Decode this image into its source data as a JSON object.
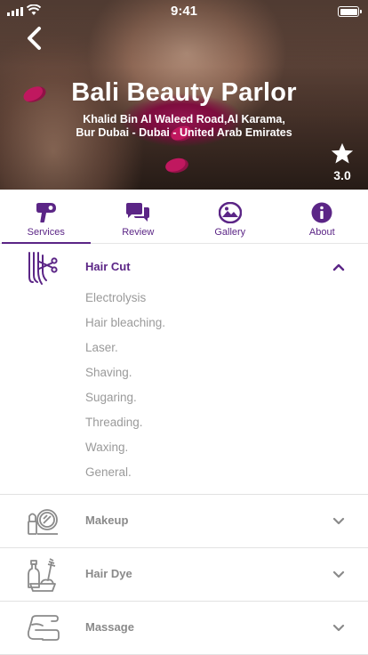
{
  "status_bar": {
    "time": "9:41"
  },
  "salon": {
    "name": "Bali Beauty Parlor",
    "address_line1": "Khalid Bin Al Waleed Road,Al Karama,",
    "address_line2": "Bur Dubai - Dubai - United Arab Emirates",
    "rating": "3.0"
  },
  "tabs": [
    {
      "label": "Services",
      "icon": "hair-dryer-icon",
      "active": true
    },
    {
      "label": "Review",
      "icon": "chat-bubbles-icon",
      "active": false
    },
    {
      "label": "Gallery",
      "icon": "image-icon",
      "active": false
    },
    {
      "label": "About",
      "icon": "info-icon",
      "active": false
    }
  ],
  "services": {
    "expanded": {
      "title": "Hair Cut",
      "icon": "hair-comb-scissors-icon",
      "items": [
        "Electrolysis",
        "Hair bleaching.",
        "Laser.",
        "Shaving.",
        "Sugaring.",
        "Threading.",
        "Waxing.",
        "General."
      ]
    },
    "collapsed": [
      {
        "title": "Makeup",
        "icon": "makeup-mirror-icon"
      },
      {
        "title": "Hair Dye",
        "icon": "hair-dye-icon"
      },
      {
        "title": "Massage",
        "icon": "massage-icon"
      }
    ]
  },
  "colors": {
    "accent": "#5b2586",
    "muted_text": "#9a9a9a",
    "divider": "#e2e2e2"
  }
}
